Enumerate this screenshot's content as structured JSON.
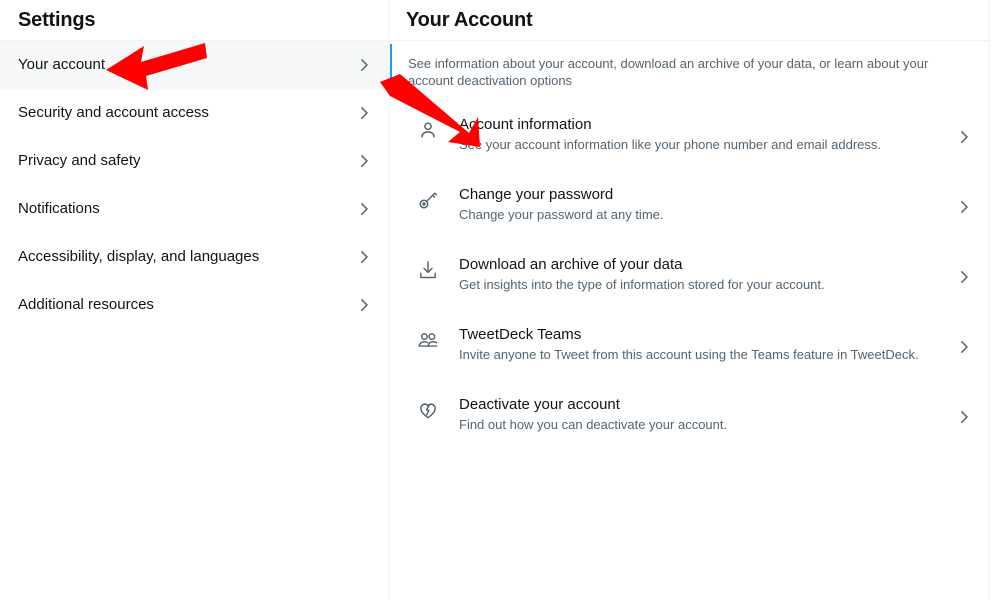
{
  "sidebar": {
    "title": "Settings",
    "items": [
      {
        "label": "Your account",
        "active": true
      },
      {
        "label": "Security and account access",
        "active": false
      },
      {
        "label": "Privacy and safety",
        "active": false
      },
      {
        "label": "Notifications",
        "active": false
      },
      {
        "label": "Accessibility, display, and languages",
        "active": false
      },
      {
        "label": "Additional resources",
        "active": false
      }
    ]
  },
  "main": {
    "title": "Your Account",
    "description": "See information about your account, download an archive of your data, or learn about your account deactivation options",
    "accent_color": "#1d9bf0",
    "items": [
      {
        "icon": "person-icon",
        "title": "Account information",
        "subtitle": "See your account information like your phone number and email address."
      },
      {
        "icon": "key-icon",
        "title": "Change your password",
        "subtitle": "Change your password at any time."
      },
      {
        "icon": "download-icon",
        "title": "Download an archive of your data",
        "subtitle": "Get insights into the type of information stored for your account."
      },
      {
        "icon": "people-icon",
        "title": "TweetDeck Teams",
        "subtitle": "Invite anyone to Tweet from this account using the Teams feature in TweetDeck."
      },
      {
        "icon": "broken-heart-icon",
        "title": "Deactivate your account",
        "subtitle": "Find out how you can deactivate your account."
      }
    ]
  },
  "annotations": {
    "color": "#fe0000",
    "arrows": [
      {
        "name": "arrow-pointing-to-your-account",
        "direction": "left"
      },
      {
        "name": "arrow-pointing-to-account-information",
        "direction": "down-right"
      }
    ]
  }
}
